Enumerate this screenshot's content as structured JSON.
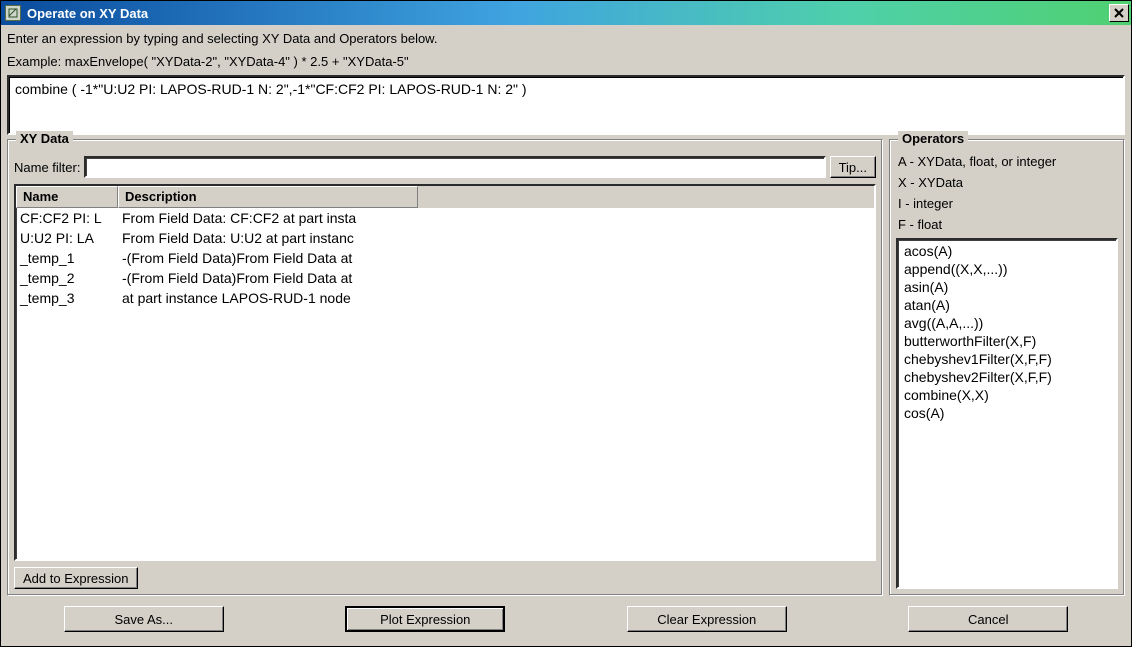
{
  "title": "Operate on XY Data",
  "instructions": "Enter an expression by typing and selecting XY Data and Operators below.",
  "example": "Example: maxEnvelope( \"XYData-2\", \"XYData-4\" ) * 2.5 + \"XYData-5\"",
  "expression": "combine ( -1*\"U:U2 PI: LAPOS-RUD-1 N: 2\",-1*\"CF:CF2 PI: LAPOS-RUD-1 N: 2\" )",
  "xydata": {
    "legend": "XY Data",
    "filter_label": "Name filter:",
    "filter_value": "",
    "tip_label": "Tip...",
    "columns": {
      "name": "Name",
      "desc": "Description"
    },
    "rows": [
      {
        "name": "CF:CF2 PI: L",
        "desc": "From Field Data: CF:CF2  at part insta"
      },
      {
        "name": "U:U2 PI: LA",
        "desc": "From Field Data: U:U2  at part instanc"
      },
      {
        "name": "_temp_1",
        "desc": "-(From Field Data)From Field Data  at"
      },
      {
        "name": "_temp_2",
        "desc": "-(From Field Data)From Field Data  at"
      },
      {
        "name": "_temp_3",
        "desc": "  at part instance LAPOS-RUD-1 node"
      }
    ],
    "add_label": "Add to Expression"
  },
  "operators": {
    "legend": "Operators",
    "keys": [
      "A - XYData, float, or integer",
      "X - XYData",
      "I - integer",
      "F - float"
    ],
    "items": [
      "acos(A)",
      "append((X,X,...))",
      "asin(A)",
      "atan(A)",
      "avg((A,A,...))",
      "butterworthFilter(X,F)",
      "chebyshev1Filter(X,F,F)",
      "chebyshev2Filter(X,F,F)",
      "combine(X,X)",
      "cos(A)"
    ]
  },
  "footer": {
    "save": "Save As...",
    "plot": "Plot Expression",
    "clear": "Clear Expression",
    "cancel": "Cancel"
  }
}
